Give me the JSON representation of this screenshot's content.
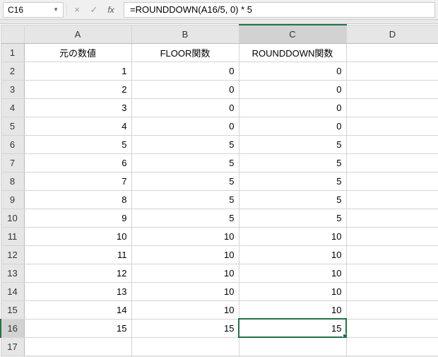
{
  "name_box": {
    "value": "C16"
  },
  "formula_bar": {
    "value": "=ROUNDDOWN(A16/5, 0) * 5"
  },
  "fb_icons": {
    "cancel": "×",
    "confirm": "✓",
    "fx": "fx"
  },
  "columns": [
    "A",
    "B",
    "C",
    "D"
  ],
  "active_column_index": 2,
  "active_row_index": 15,
  "selected_cell": {
    "row": 15,
    "col": 2
  },
  "row_count": 17,
  "headers_row": {
    "row": 0,
    "cells": [
      "元の数値",
      "FLOOR関数",
      "ROUNDDOWN関数",
      ""
    ]
  },
  "data_rows": [
    {
      "row": 1,
      "cells": [
        "1",
        "0",
        "0",
        ""
      ]
    },
    {
      "row": 2,
      "cells": [
        "2",
        "0",
        "0",
        ""
      ]
    },
    {
      "row": 3,
      "cells": [
        "3",
        "0",
        "0",
        ""
      ]
    },
    {
      "row": 4,
      "cells": [
        "4",
        "0",
        "0",
        ""
      ]
    },
    {
      "row": 5,
      "cells": [
        "5",
        "5",
        "5",
        ""
      ]
    },
    {
      "row": 6,
      "cells": [
        "6",
        "5",
        "5",
        ""
      ]
    },
    {
      "row": 7,
      "cells": [
        "7",
        "5",
        "5",
        ""
      ]
    },
    {
      "row": 8,
      "cells": [
        "8",
        "5",
        "5",
        ""
      ]
    },
    {
      "row": 9,
      "cells": [
        "9",
        "5",
        "5",
        ""
      ]
    },
    {
      "row": 10,
      "cells": [
        "10",
        "10",
        "10",
        ""
      ]
    },
    {
      "row": 11,
      "cells": [
        "11",
        "10",
        "10",
        ""
      ]
    },
    {
      "row": 12,
      "cells": [
        "12",
        "10",
        "10",
        ""
      ]
    },
    {
      "row": 13,
      "cells": [
        "13",
        "10",
        "10",
        ""
      ]
    },
    {
      "row": 14,
      "cells": [
        "14",
        "10",
        "10",
        ""
      ]
    },
    {
      "row": 15,
      "cells": [
        "15",
        "15",
        "15",
        ""
      ]
    }
  ]
}
